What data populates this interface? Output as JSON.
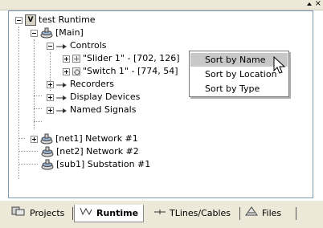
{
  "window": {
    "pin_icon": "pin-icon",
    "close_label": "×"
  },
  "tree": {
    "root": {
      "label": "test Runtime",
      "icon": "runtime-icon",
      "glyph": "V"
    },
    "main": {
      "label": "[Main]",
      "icon": "station-icon"
    },
    "controls": {
      "label": "Controls"
    },
    "slider": {
      "label": "\"Slider 1\" - [702, 126]"
    },
    "switch": {
      "label": "\"Switch 1\" - [774, 54]"
    },
    "recorders": {
      "label": "Recorders"
    },
    "display_devices": {
      "label": "Display Devices"
    },
    "named_signals": {
      "label": "Named Signals"
    },
    "net1": {
      "label": "[net1] Network #1"
    },
    "net2": {
      "label": "[net2] Network #2"
    },
    "sub1": {
      "label": "[sub1] Substation #1"
    }
  },
  "context_menu": {
    "items": [
      {
        "label": "Sort by Name",
        "selected": true
      },
      {
        "label": "Sort by Location",
        "selected": false
      },
      {
        "label": "Sort by Type",
        "selected": false
      }
    ]
  },
  "tabs": [
    {
      "label": "Projects",
      "icon": "projects-icon",
      "active": false
    },
    {
      "label": "Runtime",
      "icon": "runtime-wave-icon",
      "active": true
    },
    {
      "label": "TLines/Cables",
      "icon": "tline-icon",
      "active": false
    },
    {
      "label": "Files",
      "icon": "files-icon",
      "active": false
    }
  ],
  "colors": {
    "menu_highlight": "#c8c8c8",
    "chrome": "#ece9d8",
    "border": "#7f9db9"
  }
}
